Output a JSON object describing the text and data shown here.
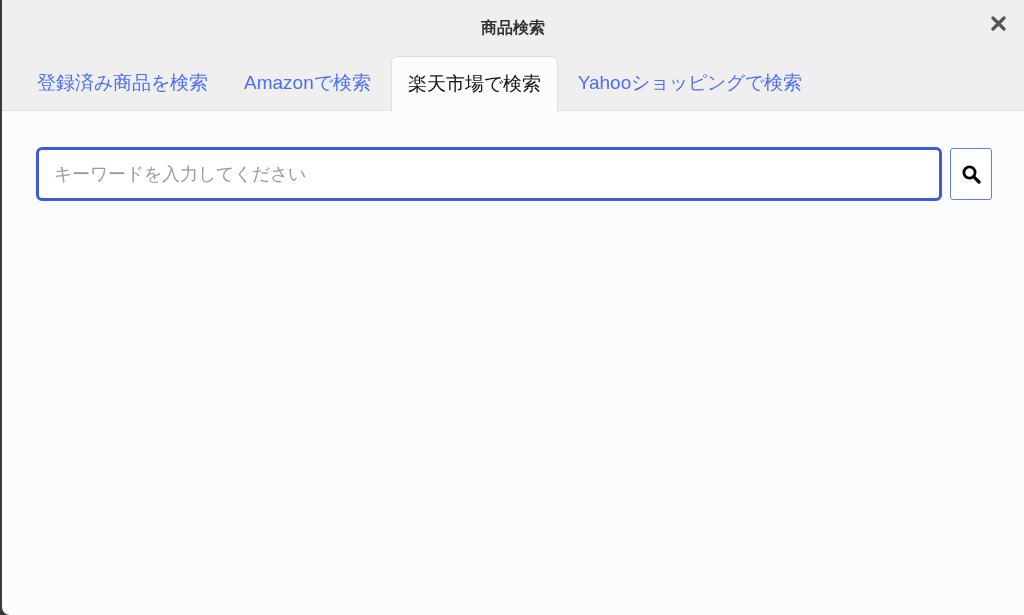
{
  "dialog": {
    "title": "商品検索"
  },
  "tabs": [
    {
      "label": "登録済み商品を検索",
      "selected": false
    },
    {
      "label": "Amazonで検索",
      "selected": false
    },
    {
      "label": "楽天市場で検索",
      "selected": true
    },
    {
      "label": "Yahooショッピングで検索",
      "selected": false
    }
  ],
  "search": {
    "placeholder": "キーワードを入力してください"
  }
}
